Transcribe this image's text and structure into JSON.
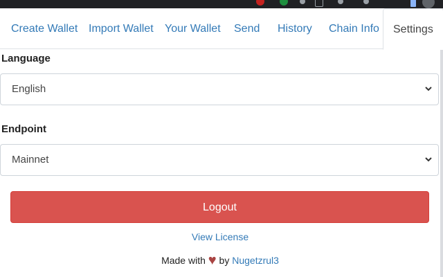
{
  "tabs": [
    {
      "label": "Create Wallet",
      "active": false
    },
    {
      "label": "Import Wallet",
      "active": false
    },
    {
      "label": "Your Wallet",
      "active": false
    },
    {
      "label": "Send",
      "active": false
    },
    {
      "label": "History",
      "active": false
    },
    {
      "label": "Chain Info",
      "active": false
    },
    {
      "label": "Settings",
      "active": true
    }
  ],
  "settings": {
    "language_label": "Language",
    "language_value": "English",
    "endpoint_label": "Endpoint",
    "endpoint_value": "Mainnet",
    "logout_label": "Logout",
    "license_link": "View License"
  },
  "footer": {
    "made_with": "Made with",
    "heart": "♥",
    "by": "by",
    "author": "Nugetzrul3"
  },
  "colors": {
    "link": "#337ab7",
    "danger": "#d9534f",
    "heart": "#a94442"
  },
  "icons": {
    "select_chevron": "chevron-down-icon",
    "heart": "heart-icon"
  }
}
